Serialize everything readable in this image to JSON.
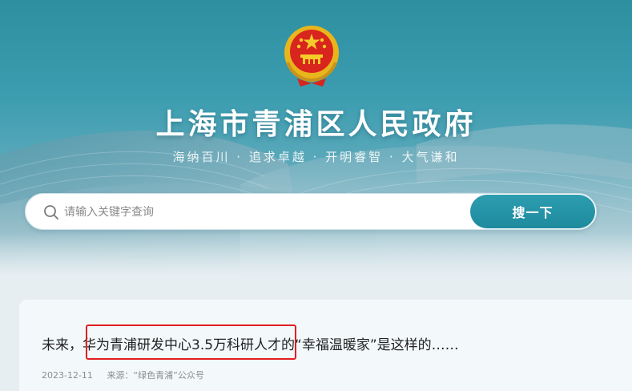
{
  "header": {
    "title": "上海市青浦区人民政府",
    "slogan": "海纳百川 · 追求卓越 · 开明睿智 · 大气谦和",
    "emblem_icon": "national-emblem-icon"
  },
  "search": {
    "placeholder": "请输入关键字查询",
    "value": "",
    "button_label": "搜一下",
    "icon": "search-icon"
  },
  "article": {
    "title": "未来，华为青浦研发中心3.5万科研人才的“幸福温暖家”是这样的……",
    "date": "2023-12-11",
    "source": "来源：“绿色青浦”公众号",
    "highlighted_phrase": "华为青浦研发中心3.5万科研人才"
  },
  "colors": {
    "accent": "#1e8a9e",
    "hero_top": "#2d8fa0",
    "highlight_border": "#e01f1f",
    "text": "#222222",
    "meta_text": "#8c8c8c"
  }
}
